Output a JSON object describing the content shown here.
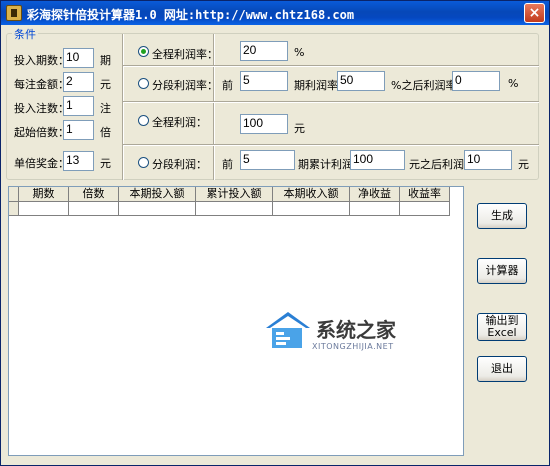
{
  "window": {
    "title": "彩海探针倍投计算器1.0 网址:http://www.chtz168.com",
    "close_glyph": "×"
  },
  "conditions": {
    "group_label": "条件",
    "periods": {
      "label": "投入期数：",
      "value": "10",
      "unit": "期"
    },
    "bet_amount": {
      "label": "每注金额：",
      "value": "2",
      "unit": "元"
    },
    "bet_count": {
      "label": "投入注数：",
      "value": "1",
      "unit": "注"
    },
    "start_multiple": {
      "label": "起始倍数：",
      "value": "1",
      "unit": "倍"
    },
    "single_prize": {
      "label": "单倍奖金：",
      "value": "13",
      "unit": "元"
    }
  },
  "modes": {
    "full_rate": {
      "label": "全程利润率：",
      "value": "20",
      "unit": "%",
      "selected": true
    },
    "seg_rate": {
      "label": "分段利润率：",
      "prefix": "前",
      "periods": "5",
      "mid_label": "期利润率",
      "rate": "50",
      "after_label": "%之后利润率",
      "after_rate": "0",
      "unit": "%"
    },
    "full_profit": {
      "label": "全程利润：",
      "value": "100",
      "unit": "元"
    },
    "seg_profit": {
      "label": "分段利润：",
      "prefix": "前",
      "periods": "5",
      "mid_label": "期累计利润",
      "amount": "100",
      "after_label": "元之后利润",
      "after_amount": "10",
      "unit": "元"
    }
  },
  "table": {
    "columns": [
      "期数",
      "倍数",
      "本期投入额",
      "累计投入额",
      "本期收入额",
      "净收益",
      "收益率"
    ]
  },
  "buttons": {
    "generate": "生成",
    "calculator": "计算器",
    "export_line1": "输出到",
    "export_line2": "Excel",
    "exit": "退出"
  },
  "watermark": {
    "text": "系统之家",
    "sub": "XITONGZHIJIA.NET"
  }
}
